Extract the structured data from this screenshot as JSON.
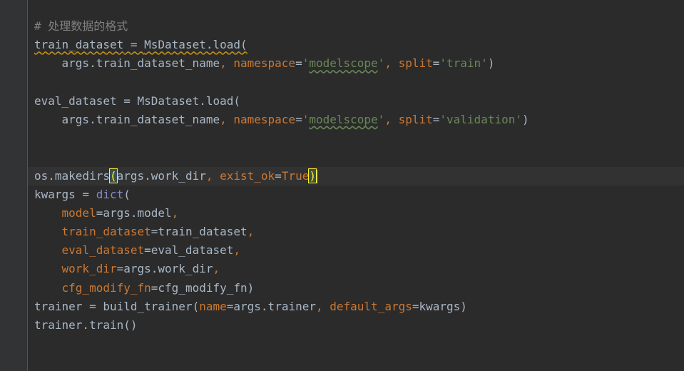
{
  "editor": {
    "lines": [
      "# 处理数据的格式",
      "train_dataset = MsDataset.load(",
      "    args.train_dataset_name, namespace='modelscope', split='train')",
      "",
      "eval_dataset = MsDataset.load(",
      "    args.train_dataset_name, namespace='modelscope', split='validation')",
      "",
      "",
      "os.makedirs(args.work_dir, exist_ok=True)",
      "kwargs = dict(",
      "    model=args.model,",
      "    train_dataset=train_dataset,",
      "    eval_dataset=eval_dataset,",
      "    work_dir=args.work_dir,",
      "    cfg_modify_fn=cfg_modify_fn)",
      "trainer = build_trainer(name=args.trainer, default_args=kwargs)",
      "trainer.train()"
    ],
    "tokens": {
      "comment": "# 处理数据的格式",
      "train_dataset": "train_dataset",
      "eq": " = ",
      "msdataset_load": "MsDataset.load(",
      "indent": "    ",
      "args_train_dataset_name": "args.train_dataset_name",
      "comma": ", ",
      "namespace": "namespace",
      "eq_plain": "=",
      "quote": "'",
      "modelscope": "modelscope",
      "split": "split",
      "train_str": "'train'",
      "close_paren": ")",
      "eval_dataset": "eval_dataset",
      "validation_str": "'validation'",
      "os_makedirs": "os.makedirs",
      "open_paren": "(",
      "args_work_dir": "args.work_dir",
      "exist_ok": "exist_ok",
      "true_kw": "True",
      "kwargs": "kwargs",
      "dict": "dict",
      "model": "model",
      "args_model": "args.model",
      "comma_only": ",",
      "work_dir": "work_dir",
      "cfg_modify_fn": "cfg_modify_fn",
      "trainer": "trainer",
      "build_trainer": "build_trainer",
      "name": "name",
      "args_trainer": "args.trainer",
      "default_args": "default_args",
      "trainer_train": "trainer.train()"
    }
  },
  "colors": {
    "background": "#2b2b2b",
    "gutter": "#313335",
    "text": "#a9b7c6",
    "comment": "#808080",
    "keyword": "#cc7832",
    "string": "#6a8759",
    "builtin": "#8888c6",
    "brace_match": "#ffef28"
  }
}
